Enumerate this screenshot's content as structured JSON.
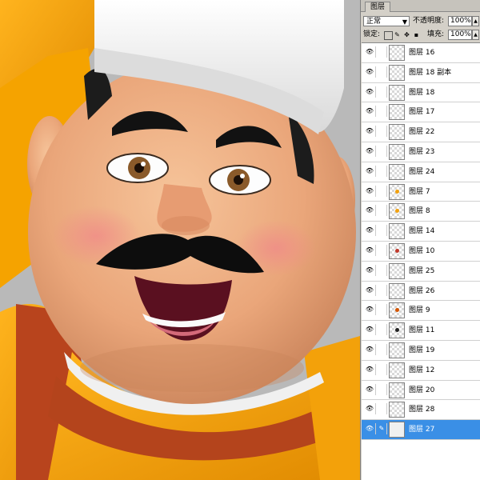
{
  "panel": {
    "tab_label": "图层",
    "blend_mode": "正常",
    "opacity_label": "不透明度:",
    "opacity_value": "100%",
    "lock_label": "锁定:",
    "fill_label": "填充:",
    "fill_value": "100%"
  },
  "layers": [
    {
      "name": "图层 16",
      "thumb": "blank"
    },
    {
      "name": "图层 18 副本",
      "thumb": "blank"
    },
    {
      "name": "图层 18",
      "thumb": "blank"
    },
    {
      "name": "图层 17",
      "thumb": "blank"
    },
    {
      "name": "图层 22",
      "thumb": "blank"
    },
    {
      "name": "图层 23",
      "thumb": "blank"
    },
    {
      "name": "图层 24",
      "thumb": "blank"
    },
    {
      "name": "图层 7",
      "thumb": "orange"
    },
    {
      "name": "图层 8",
      "thumb": "orange"
    },
    {
      "name": "图层 14",
      "thumb": "blank"
    },
    {
      "name": "图层 10",
      "thumb": "red"
    },
    {
      "name": "图层 25",
      "thumb": "blank"
    },
    {
      "name": "图层 26",
      "thumb": "blank"
    },
    {
      "name": "图层 9",
      "thumb": "ring"
    },
    {
      "name": "图层 11",
      "thumb": "dark"
    },
    {
      "name": "图层 19",
      "thumb": "blank"
    },
    {
      "name": "图层 12",
      "thumb": "blank"
    },
    {
      "name": "图层 20",
      "thumb": "blank"
    },
    {
      "name": "图层 28",
      "thumb": "blank"
    },
    {
      "name": "图层 27",
      "thumb": "solid",
      "selected": true
    }
  ],
  "colors": {
    "selection": "#3a8fe6",
    "robe": "#f2a20c",
    "skin": "#f0b086",
    "hat": "#f4f4f4"
  }
}
